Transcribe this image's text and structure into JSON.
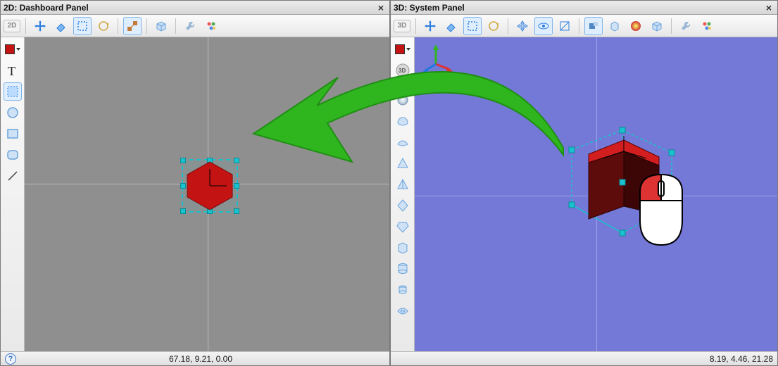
{
  "left": {
    "title": "2D: Dashboard Panel",
    "mode": "2D",
    "coords": "67.18, 9.21, 0.00"
  },
  "right": {
    "title": "3D: System Panel",
    "mode": "3D",
    "coords": "8.19, 4.46, 21.28"
  },
  "colors": {
    "accent": "#c31313",
    "viewport2d": "#8f8f8f",
    "viewport3d": "#7478d6",
    "selection": "#19c2cf",
    "arrow": "#2fb61f"
  }
}
